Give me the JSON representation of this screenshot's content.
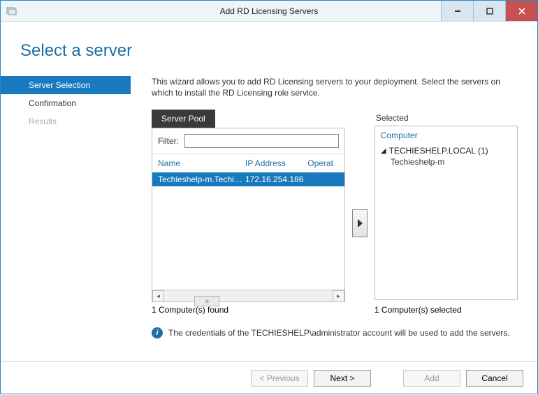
{
  "window": {
    "title": "Add RD Licensing Servers"
  },
  "heading": "Select a server",
  "sidebar": {
    "items": [
      {
        "label": "Server Selection",
        "active": true,
        "disabled": false
      },
      {
        "label": "Confirmation",
        "active": false,
        "disabled": false
      },
      {
        "label": "Results",
        "active": false,
        "disabled": true
      }
    ]
  },
  "intro": "This wizard allows you to add RD Licensing servers to your deployment. Select the servers on which to install the RD Licensing role service.",
  "pool": {
    "tab_label": "Server Pool",
    "filter_label": "Filter:",
    "filter_value": "",
    "columns": {
      "name": "Name",
      "ip": "IP Address",
      "os": "Operat"
    },
    "rows": [
      {
        "name": "Techieshelp-m.Techiesh...",
        "ip": "172.16.254.186",
        "os": ""
      }
    ],
    "found_text": "1 Computer(s) found"
  },
  "selected": {
    "panel_label": "Selected",
    "column_label": "Computer",
    "domain": "TECHIESHELP.LOCAL (1)",
    "items": [
      "Techieshelp-m"
    ],
    "selected_text": "1 Computer(s) selected"
  },
  "info_text": "The credentials of the TECHIESHELP\\administrator account will be used to add the servers.",
  "footer": {
    "previous": "< Previous",
    "next": "Next >",
    "add": "Add",
    "cancel": "Cancel"
  }
}
